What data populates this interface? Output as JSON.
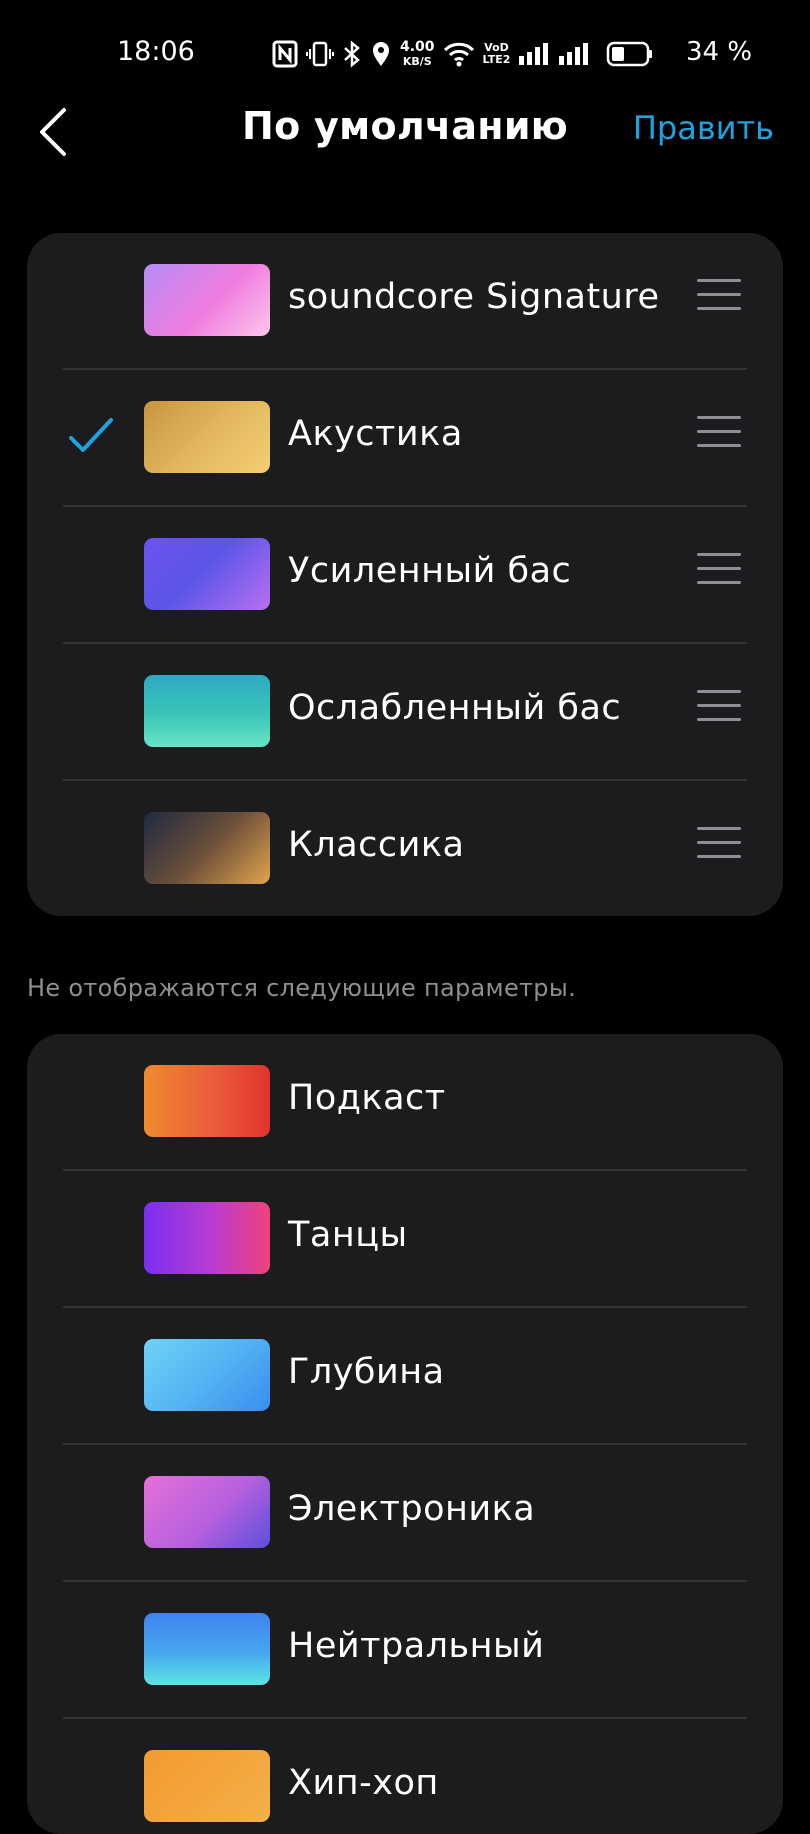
{
  "status_bar": {
    "time": "18:06",
    "net_speed_value": "4.00",
    "net_speed_unit": "KB/S",
    "volte_top": "VoD",
    "volte_bottom": "LTE2",
    "battery_percent": "34 %",
    "icons": [
      "nfc-icon",
      "vibrate-icon",
      "bluetooth-icon",
      "location-icon",
      "wifi-icon",
      "signal-icon",
      "signal-icon",
      "battery-icon"
    ]
  },
  "header": {
    "title": "По умолчанию",
    "edit_label": "Править",
    "accent_color": "#1fa3e0"
  },
  "visible_presets": [
    {
      "label": "soundcore Signature",
      "selected": false
    },
    {
      "label": "Акустика",
      "selected": true
    },
    {
      "label": "Усиленный бас",
      "selected": false
    },
    {
      "label": "Ослабленный бас",
      "selected": false
    },
    {
      "label": "Классика",
      "selected": false
    }
  ],
  "hidden_section": {
    "note": "Не отображаются следующие параметры.",
    "items": [
      {
        "label": "Подкаст"
      },
      {
        "label": "Танцы"
      },
      {
        "label": "Глубина"
      },
      {
        "label": "Электроника"
      },
      {
        "label": "Нейтральный"
      },
      {
        "label": "Хип-хоп"
      }
    ]
  }
}
